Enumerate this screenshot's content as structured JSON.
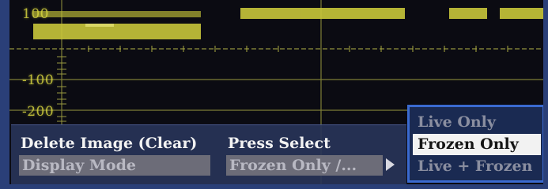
{
  "waveform": {
    "axis_labels": [
      "100",
      "-100",
      "-200"
    ],
    "trace_color": "#d8d640",
    "grid_color": "#8a8a3a"
  },
  "menu": {
    "rows": [
      {
        "label": "Delete Image (Clear)",
        "value": "Display Mode"
      },
      {
        "label": "Press Select",
        "value": "Frozen Only /..."
      }
    ]
  },
  "popup": {
    "options": [
      "Live Only",
      "Frozen Only",
      "Live + Frozen"
    ],
    "selected": "Frozen Only"
  }
}
